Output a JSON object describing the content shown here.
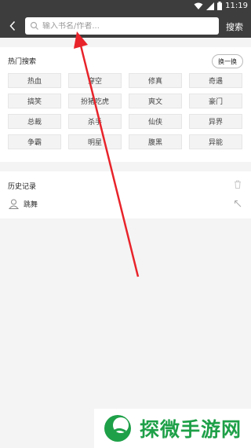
{
  "status_bar": {
    "time": "11:19"
  },
  "header": {
    "search_placeholder": "输入书名/作者...",
    "search_button": "搜索"
  },
  "hot_search": {
    "title": "热门搜索",
    "swap_button": "换一换",
    "tags": [
      "热血",
      "穿空",
      "修真",
      "奇遇",
      "搞笑",
      "扮猪吃虎",
      "爽文",
      "豪门",
      "总裁",
      "杀手",
      "仙侠",
      "异界",
      "争霸",
      "明星",
      "腹黑",
      "异能"
    ]
  },
  "history": {
    "title": "历史记录",
    "items": [
      {
        "text": "跳舞"
      }
    ]
  },
  "watermark": {
    "text": "探微手游网"
  },
  "colors": {
    "header_bg": "#3d3d3d",
    "annotation_arrow": "#e8232a",
    "watermark_green": "#1ea048"
  }
}
